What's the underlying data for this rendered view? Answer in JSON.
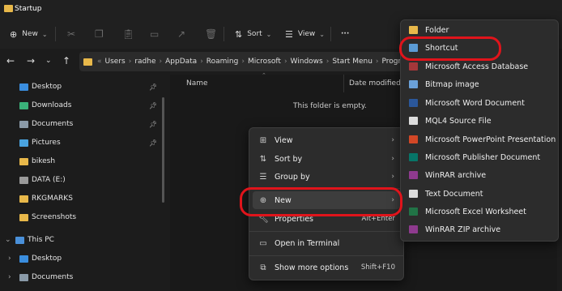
{
  "window": {
    "title": "Startup"
  },
  "toolbar": {
    "new_label": "New",
    "sort_label": "Sort",
    "view_label": "View",
    "more_label": "···"
  },
  "address": {
    "crumbs": [
      "Users",
      "radhe",
      "AppData",
      "Roaming",
      "Microsoft",
      "Windows",
      "Start Menu",
      "Program"
    ]
  },
  "sidebar": {
    "items": [
      {
        "label": "Desktop",
        "icon": "desktop-icon",
        "color": "#3a8dde",
        "pinned": true
      },
      {
        "label": "Downloads",
        "icon": "downloads-icon",
        "color": "#3ab27a",
        "pinned": true
      },
      {
        "label": "Documents",
        "icon": "documents-icon",
        "color": "#8a9aa8",
        "pinned": true
      },
      {
        "label": "Pictures",
        "icon": "pictures-icon",
        "color": "#4aa3df",
        "pinned": true
      },
      {
        "label": "bikesh",
        "icon": "folder-icon",
        "color": "#e8b84a",
        "pinned": false
      },
      {
        "label": "DATA (E:)",
        "icon": "drive-icon",
        "color": "#9a9a9a",
        "pinned": false
      },
      {
        "label": "RKGMARKS",
        "icon": "folder-icon",
        "color": "#e8b84a",
        "pinned": false
      },
      {
        "label": "Screenshots",
        "icon": "folder-icon",
        "color": "#e8b84a",
        "pinned": false
      },
      {
        "label": "This PC",
        "icon": "this-pc-icon",
        "color": "#4a90d9",
        "pinned": false
      },
      {
        "label": "Desktop",
        "icon": "desktop-icon",
        "color": "#3a8dde",
        "pinned": false
      },
      {
        "label": "Documents",
        "icon": "documents-icon",
        "color": "#8a9aa8",
        "pinned": false
      }
    ]
  },
  "content": {
    "col_name": "Name",
    "col_date": "Date modified",
    "empty_text": "This folder is empty."
  },
  "context_menu": {
    "view": "View",
    "sort_by": "Sort by",
    "group_by": "Group by",
    "new": "New",
    "properties": "Properties",
    "properties_shortcut": "Alt+Enter",
    "open_terminal": "Open in Terminal",
    "show_more": "Show more options",
    "show_more_shortcut": "Shift+F10"
  },
  "new_submenu": {
    "items": [
      {
        "label": "Folder",
        "icon": "folder-icon",
        "color": "#e8b84a"
      },
      {
        "label": "Shortcut",
        "icon": "shortcut-icon",
        "color": "#5b9bd5"
      },
      {
        "label": "Microsoft Access Database",
        "icon": "access-icon",
        "color": "#a4373a"
      },
      {
        "label": "Bitmap image",
        "icon": "bitmap-icon",
        "color": "#6aa0d8"
      },
      {
        "label": "Microsoft Word Document",
        "icon": "word-icon",
        "color": "#2b579a"
      },
      {
        "label": "MQL4 Source File",
        "icon": "mql4-file-icon",
        "color": "#dcdcdc"
      },
      {
        "label": "Microsoft PowerPoint Presentation",
        "icon": "powerpoint-icon",
        "color": "#d24726"
      },
      {
        "label": "Microsoft Publisher Document",
        "icon": "publisher-icon",
        "color": "#077568"
      },
      {
        "label": "WinRAR archive",
        "icon": "winrar-icon",
        "color": "#8e3a8e"
      },
      {
        "label": "Text Document",
        "icon": "text-document-icon",
        "color": "#dcdcdc"
      },
      {
        "label": "Microsoft Excel Worksheet",
        "icon": "excel-icon",
        "color": "#217346"
      },
      {
        "label": "WinRAR ZIP archive",
        "icon": "winrar-zip-icon",
        "color": "#8e3a8e"
      }
    ]
  },
  "highlight_color": "#e0141b"
}
